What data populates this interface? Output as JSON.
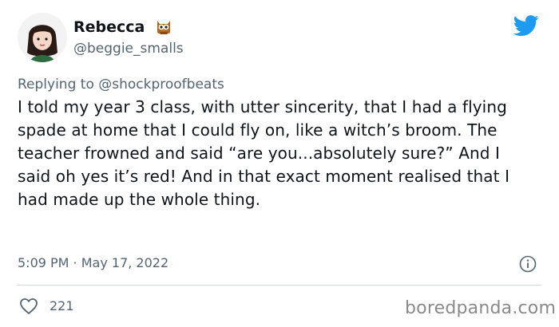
{
  "author": {
    "display_name": "Rebecca",
    "handle": "@beggie_smalls",
    "badge_icon": "owl-icon",
    "avatar_icon": "cartoon-avatar"
  },
  "reply": {
    "prefix": "Replying to ",
    "mention": "@shockproofbeats"
  },
  "tweet": {
    "text": "I told my year 3 class, with utter sincerity, that I had a flying spade at home that I could fly on, like a witch’s broom. The teacher frowned and said “are you...absolutely sure?” And I said oh yes it’s red! And in that exact moment realised that I had made up the whole thing.",
    "timestamp": "5:09 PM · May 17, 2022"
  },
  "engagement": {
    "likes": "221",
    "like_icon": "heart-icon",
    "info_icon": "info-icon"
  },
  "watermark": "boredpanda.com",
  "colors": {
    "twitter_blue": "#1d9bf0",
    "secondary_text": "#536471",
    "primary_text": "#0f1419",
    "divider": "#cfd9de"
  }
}
